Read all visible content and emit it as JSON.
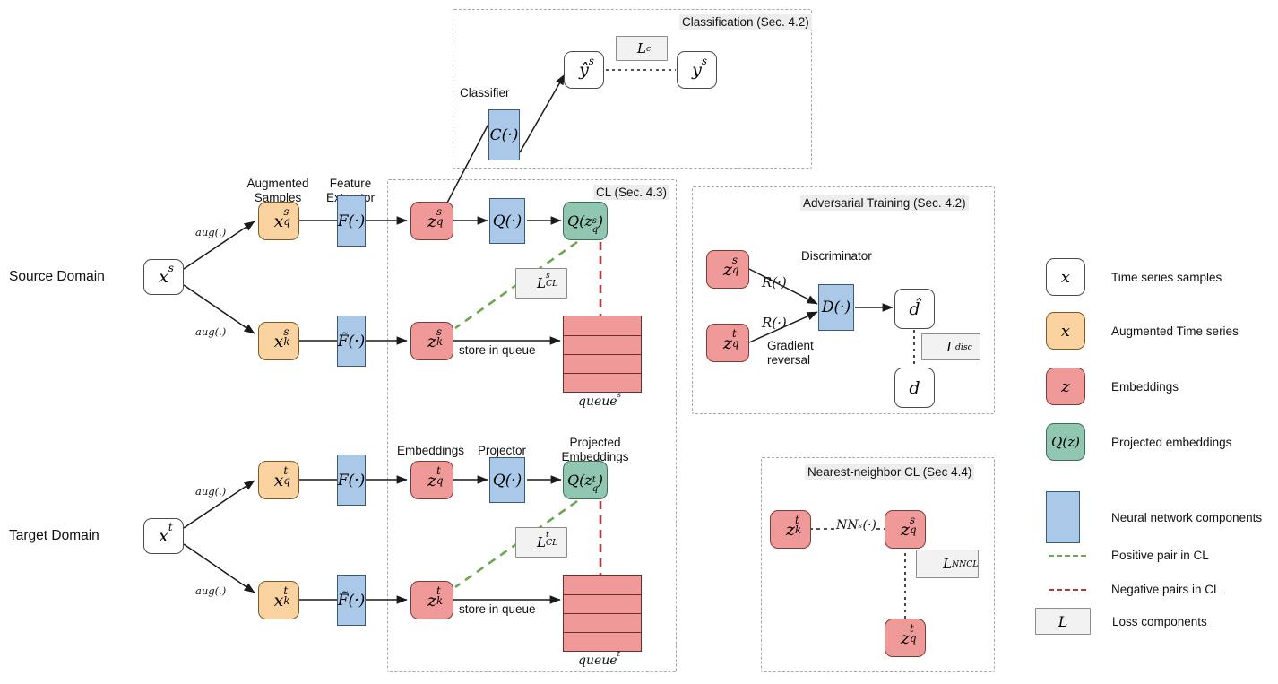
{
  "domains": {
    "source_label": "Source Domain",
    "target_label": "Target Domain"
  },
  "column_labels": {
    "augmented_samples": "Augmented\nSamples",
    "feature_extractor": "Feature\nExtractor",
    "embeddings": "Embeddings",
    "projector": "Projector",
    "projected_embeddings": "Projected\nEmbeddings",
    "classifier": "Classifier",
    "discriminator": "Discriminator",
    "gradient_reversal": "Gradient\nreversal",
    "store_in_queue": "store in queue"
  },
  "groups": [
    {
      "id": "classification",
      "title": "Classification (Sec. 4.2)"
    },
    {
      "id": "cl",
      "title": "CL (Sec. 4.3)"
    },
    {
      "id": "adversarial",
      "title": "Adversarial Training (Sec. 4.2)"
    },
    {
      "id": "nncl",
      "title": "Nearest-neighbor CL (Sec 4.4)"
    }
  ],
  "edge_labels": {
    "aug": "aug(.)",
    "grad_rev_fn": "R(·)",
    "nn_fn": "NN",
    "nn_sub": "s",
    "nn_tail": "(·)"
  },
  "nodes": {
    "x_s": {
      "base": "x",
      "sup": "s",
      "sub": ""
    },
    "x_t": {
      "base": "x",
      "sup": "t",
      "sub": ""
    },
    "xq_s": {
      "base": "x",
      "sup": "s",
      "sub": "q"
    },
    "xk_s": {
      "base": "x",
      "sup": "s",
      "sub": "k"
    },
    "xq_t": {
      "base": "x",
      "sup": "t",
      "sub": "q"
    },
    "xk_t": {
      "base": "x",
      "sup": "t",
      "sub": "k"
    },
    "F": {
      "label": "F(·)"
    },
    "Ftilde": {
      "label": "F̃(·)"
    },
    "zq_s": {
      "base": "z",
      "sup": "s",
      "sub": "q"
    },
    "zk_s": {
      "base": "z",
      "sup": "s",
      "sub": "k"
    },
    "zq_t": {
      "base": "z",
      "sup": "t",
      "sub": "q"
    },
    "zk_t": {
      "base": "z",
      "sup": "t",
      "sub": "k"
    },
    "Q": {
      "label": "Q(·)"
    },
    "Qzq_s": {
      "label": "Q(z",
      "sup": "s",
      "sub": "q",
      "tail": ")"
    },
    "Qzq_t": {
      "label": "Q(z",
      "sup": "t",
      "sub": "q",
      "tail": ")"
    },
    "C": {
      "label": "C(·)"
    },
    "D": {
      "label": "D(·)"
    },
    "yhat_s": {
      "base": "ŷ",
      "sup": "s",
      "sub": ""
    },
    "y_s": {
      "base": "y",
      "sup": "s",
      "sub": ""
    },
    "dhat": {
      "base": "d̂",
      "sup": "",
      "sub": ""
    },
    "d": {
      "base": "d",
      "sup": "",
      "sub": ""
    },
    "queue_s": {
      "caption_base": "queue",
      "caption_sup": "s"
    },
    "queue_t": {
      "caption_base": "queue",
      "caption_sup": "t"
    }
  },
  "losses": {
    "Lc": {
      "base": "L",
      "sub": "c",
      "sup": ""
    },
    "LCL_s": {
      "base": "L",
      "sub": "CL",
      "sup": "s"
    },
    "LCL_t": {
      "base": "L",
      "sub": "CL",
      "sup": "t"
    },
    "Ldisc": {
      "base": "L",
      "sub": "disc",
      "sup": ""
    },
    "LNNCL": {
      "base": "L",
      "sub": "NNCL",
      "sup": ""
    }
  },
  "legend": [
    {
      "id": "time-series-samples",
      "shape": "box-white",
      "symbol": "x",
      "text": "Time series samples"
    },
    {
      "id": "augmented-time-series",
      "shape": "box-orange",
      "symbol": "x",
      "text": "Augmented Time series"
    },
    {
      "id": "embeddings",
      "shape": "box-red",
      "symbol": "z",
      "text": "Embeddings"
    },
    {
      "id": "projected-embeddings",
      "shape": "box-green",
      "symbol": "Q(z)",
      "text": "Projected embeddings"
    },
    {
      "id": "neural-network",
      "shape": "box-blue",
      "symbol": "",
      "text": "Neural network components"
    },
    {
      "id": "positive-pair",
      "shape": "dash-green",
      "symbol": "",
      "text": "Positive pair in CL"
    },
    {
      "id": "negative-pairs",
      "shape": "dash-red",
      "symbol": "",
      "text": "Negative pairs in CL"
    },
    {
      "id": "loss-components",
      "shape": "box-loss",
      "symbol": "L",
      "text": "Loss components"
    }
  ],
  "colors": {
    "white_box": "#ffffff",
    "orange_box": "#fbd3a0",
    "red_box": "#ef9a99",
    "green_box": "#91c7b1",
    "blue_box": "#aac8e8",
    "loss_box": "#f2f2f2",
    "positive_pair": "#6aa84f",
    "negative_pair": "#b03a3a",
    "group_border": "#a8a8a8",
    "arrow": "#1a1a1a"
  }
}
